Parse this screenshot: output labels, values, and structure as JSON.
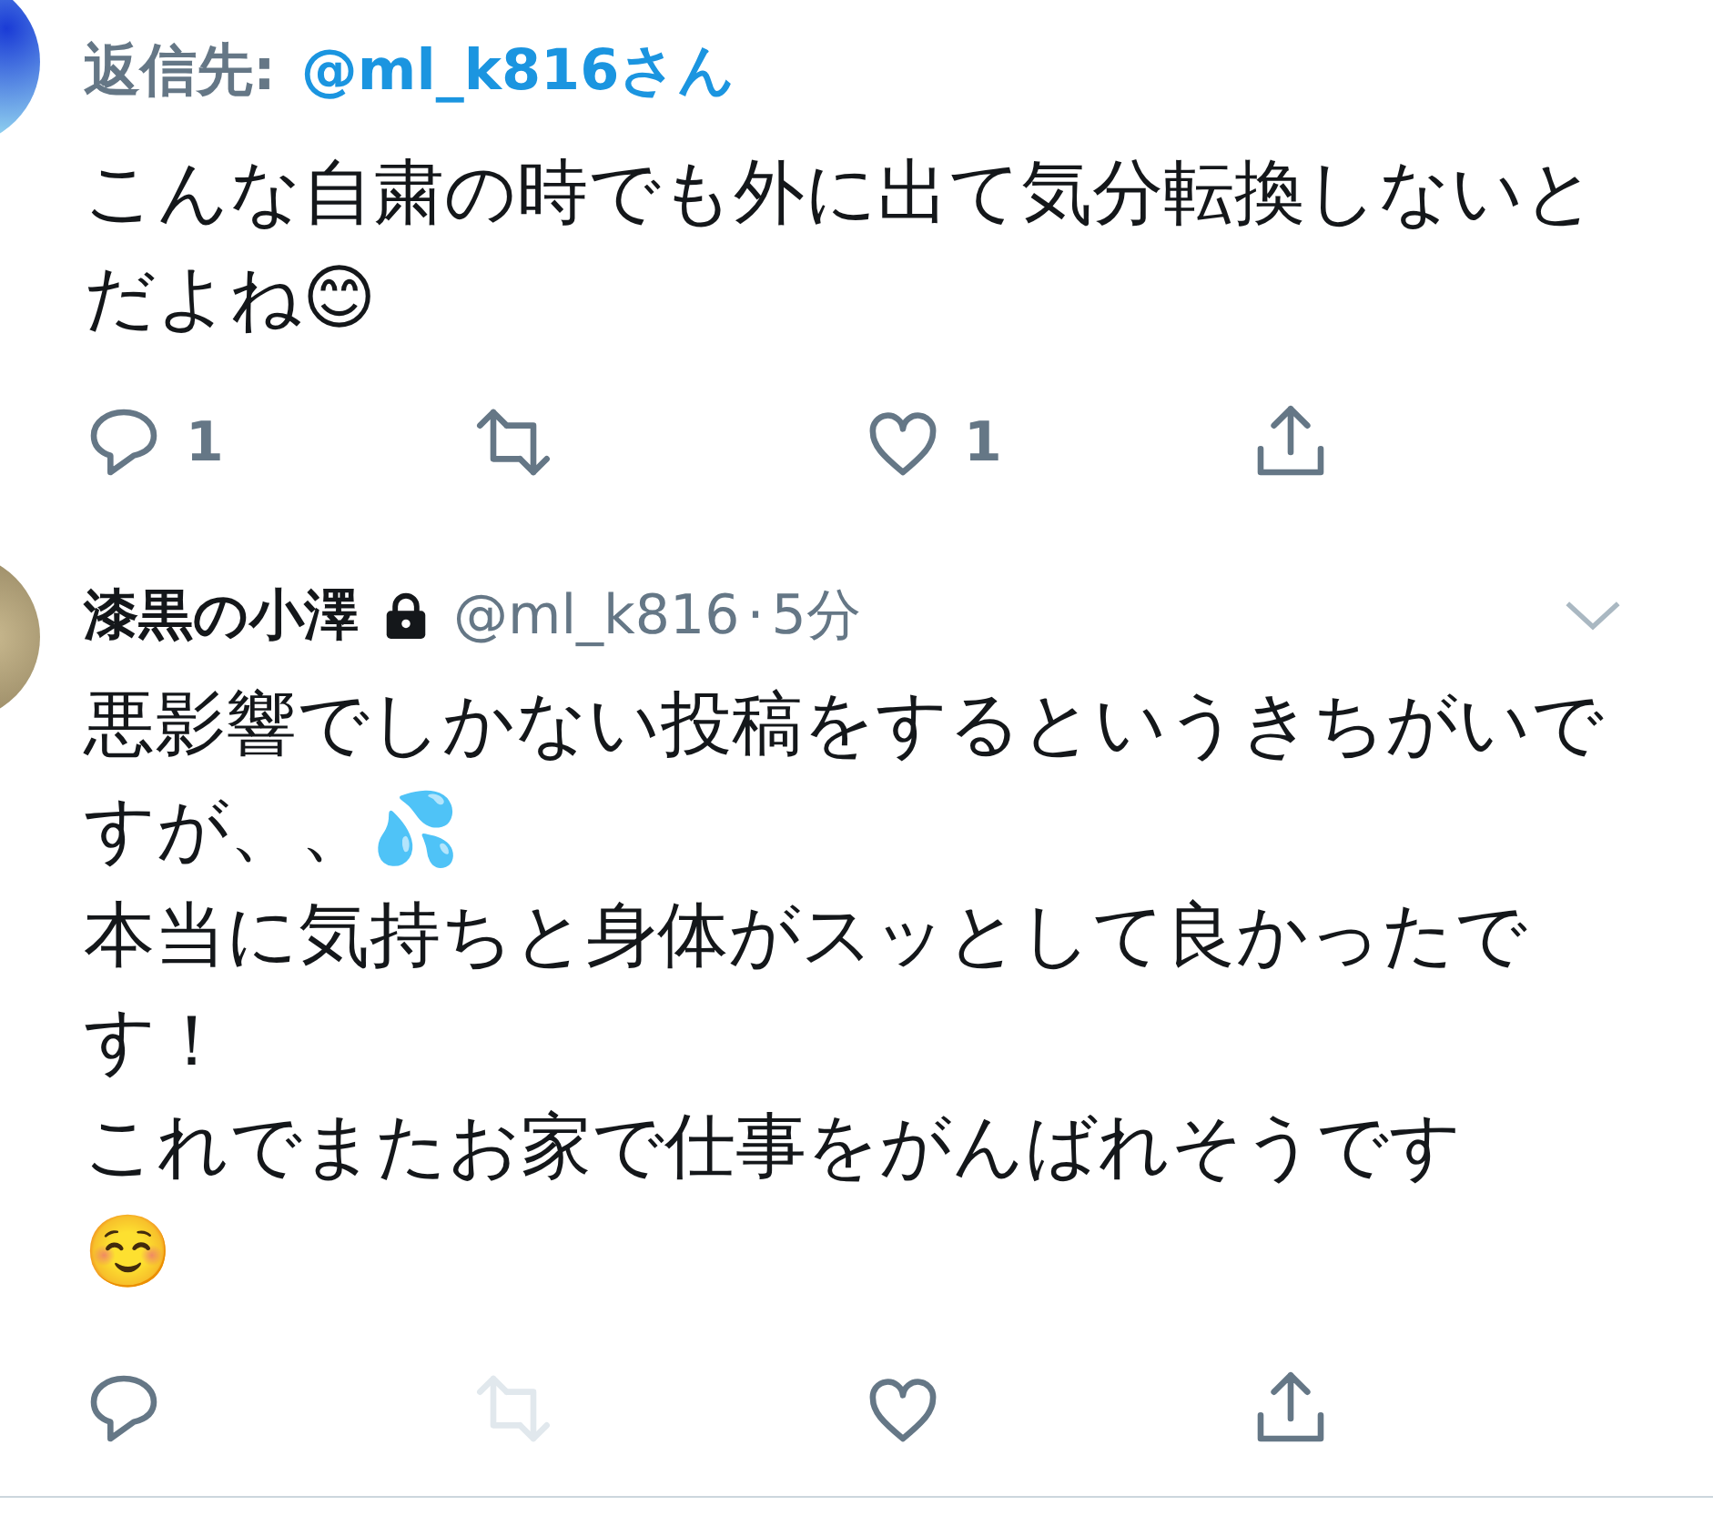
{
  "tweets": [
    {
      "reply_to": {
        "label": "返信先:",
        "handle": "@ml_k816さん"
      },
      "paragraphs": [
        "こんな自粛の時でも外に出て気分転換しないとだよね😊"
      ],
      "actions": [
        {
          "kind": "reply",
          "count": "1",
          "disabled": false
        },
        {
          "kind": "retweet",
          "disabled": false
        },
        {
          "kind": "like",
          "count": "1",
          "disabled": false
        },
        {
          "kind": "share",
          "disabled": false
        }
      ]
    },
    {
      "name": "漆黒の小澤",
      "protected": true,
      "handle": "@ml_k816",
      "separator": "·",
      "time": "5分",
      "paragraphs": [
        "悪影響でしかない投稿をするというきちがいですが、、💦",
        "本当に気持ちと身体がスッとして良かったです！",
        "これでまたお家で仕事をがんばれそうです",
        "☺️"
      ],
      "actions": [
        {
          "kind": "reply",
          "disabled": false
        },
        {
          "kind": "retweet",
          "disabled": true
        },
        {
          "kind": "like",
          "disabled": false
        },
        {
          "kind": "share",
          "disabled": false
        }
      ]
    }
  ]
}
